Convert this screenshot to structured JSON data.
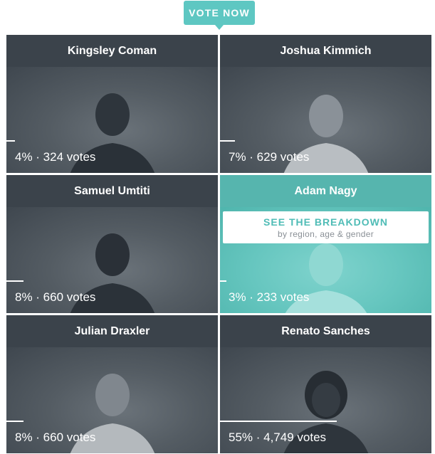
{
  "vote_button": {
    "label": "VOTE NOW"
  },
  "players": [
    {
      "name": "Kingsley Coman",
      "result": "4% · 324 votes",
      "percent": 4
    },
    {
      "name": "Joshua Kimmich",
      "result": "7% · 629 votes",
      "percent": 7
    },
    {
      "name": "Samuel Umtiti",
      "result": "8% · 660 votes",
      "percent": 8
    },
    {
      "name": "Adam Nagy",
      "result": "3% · 233 votes",
      "percent": 3
    },
    {
      "name": "Julian Draxler",
      "result": "8% · 660 votes",
      "percent": 8
    },
    {
      "name": "Renato Sanches",
      "result": "55% · 4,749 votes",
      "percent": 55
    }
  ],
  "breakdown": {
    "title": "SEE THE BREAKDOWN",
    "subtitle": "by region, age & gender"
  },
  "colors": {
    "accent": "#5ec7c2",
    "card": "#4a525a",
    "highlight": "#5cc3bb"
  }
}
